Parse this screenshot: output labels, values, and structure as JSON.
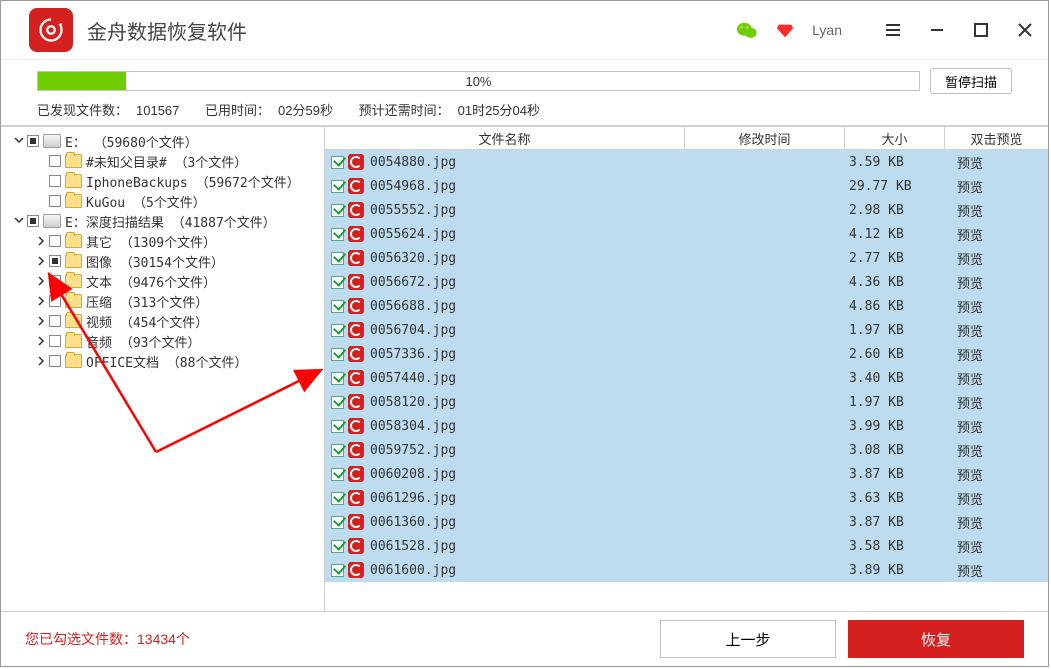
{
  "app": {
    "title": "金舟数据恢复软件",
    "username": "Lyan"
  },
  "progress": {
    "percent": 10,
    "percent_label": "10%",
    "pause_btn": "暂停扫描"
  },
  "status": {
    "found_label": "已发现文件数：",
    "found": "101567",
    "elapsed_label": "已用时间：",
    "elapsed": "02分59秒",
    "eta_label": "预计还需时间：",
    "eta": "01时25分04秒"
  },
  "tree": [
    {
      "depth": 0,
      "caret": "down",
      "check": "square",
      "icon": "drive",
      "text": "E： （59680个文件）"
    },
    {
      "depth": 1,
      "caret": "none",
      "check": "empty",
      "icon": "folder",
      "text": "#未知父目录#   （3个文件）"
    },
    {
      "depth": 1,
      "caret": "none",
      "check": "empty",
      "icon": "folder",
      "text": "IphoneBackups   （59672个文件）"
    },
    {
      "depth": 1,
      "caret": "none",
      "check": "empty",
      "icon": "folder",
      "text": "KuGou   （5个文件）"
    },
    {
      "depth": 0,
      "caret": "down",
      "check": "square",
      "icon": "drive",
      "text": "E：深度扫描结果   （41887个文件）"
    },
    {
      "depth": 1,
      "caret": "right",
      "check": "empty",
      "icon": "folder",
      "text": "其它   （1309个文件）"
    },
    {
      "depth": 1,
      "caret": "right",
      "check": "square",
      "icon": "folder",
      "text": "图像   （30154个文件）"
    },
    {
      "depth": 1,
      "caret": "right",
      "check": "empty",
      "icon": "folder",
      "text": "文本   （9476个文件）"
    },
    {
      "depth": 1,
      "caret": "right",
      "check": "empty",
      "icon": "folder",
      "text": "压缩   （313个文件）"
    },
    {
      "depth": 1,
      "caret": "right",
      "check": "empty",
      "icon": "folder",
      "text": "视频   （454个文件）"
    },
    {
      "depth": 1,
      "caret": "right",
      "check": "empty",
      "icon": "folder",
      "text": "音频   （93个文件）"
    },
    {
      "depth": 1,
      "caret": "right",
      "check": "empty",
      "icon": "folder",
      "text": "OFFICE文档   （88个文件）"
    }
  ],
  "columns": {
    "name": "文件名称",
    "time": "修改时间",
    "size": "大小",
    "preview": "双击预览"
  },
  "preview_label": "预览",
  "files": [
    {
      "name": "0054880.jpg",
      "size": "3.59 KB"
    },
    {
      "name": "0054968.jpg",
      "size": "29.77 KB"
    },
    {
      "name": "0055552.jpg",
      "size": "2.98 KB"
    },
    {
      "name": "0055624.jpg",
      "size": "4.12 KB"
    },
    {
      "name": "0056320.jpg",
      "size": "2.77 KB"
    },
    {
      "name": "0056672.jpg",
      "size": "4.36 KB"
    },
    {
      "name": "0056688.jpg",
      "size": "4.86 KB"
    },
    {
      "name": "0056704.jpg",
      "size": "1.97 KB"
    },
    {
      "name": "0057336.jpg",
      "size": "2.60 KB"
    },
    {
      "name": "0057440.jpg",
      "size": "3.40 KB"
    },
    {
      "name": "0058120.jpg",
      "size": "1.97 KB"
    },
    {
      "name": "0058304.jpg",
      "size": "3.99 KB"
    },
    {
      "name": "0059752.jpg",
      "size": "3.08 KB"
    },
    {
      "name": "0060208.jpg",
      "size": "3.87 KB"
    },
    {
      "name": "0061296.jpg",
      "size": "3.63 KB"
    },
    {
      "name": "0061360.jpg",
      "size": "3.87 KB"
    },
    {
      "name": "0061528.jpg",
      "size": "3.58 KB"
    },
    {
      "name": "0061600.jpg",
      "size": "3.89 KB"
    }
  ],
  "footer": {
    "selected_prefix": "您已勾选文件数：",
    "selected": "13434个",
    "prev_btn": "上一步",
    "recover_btn": "恢复"
  }
}
